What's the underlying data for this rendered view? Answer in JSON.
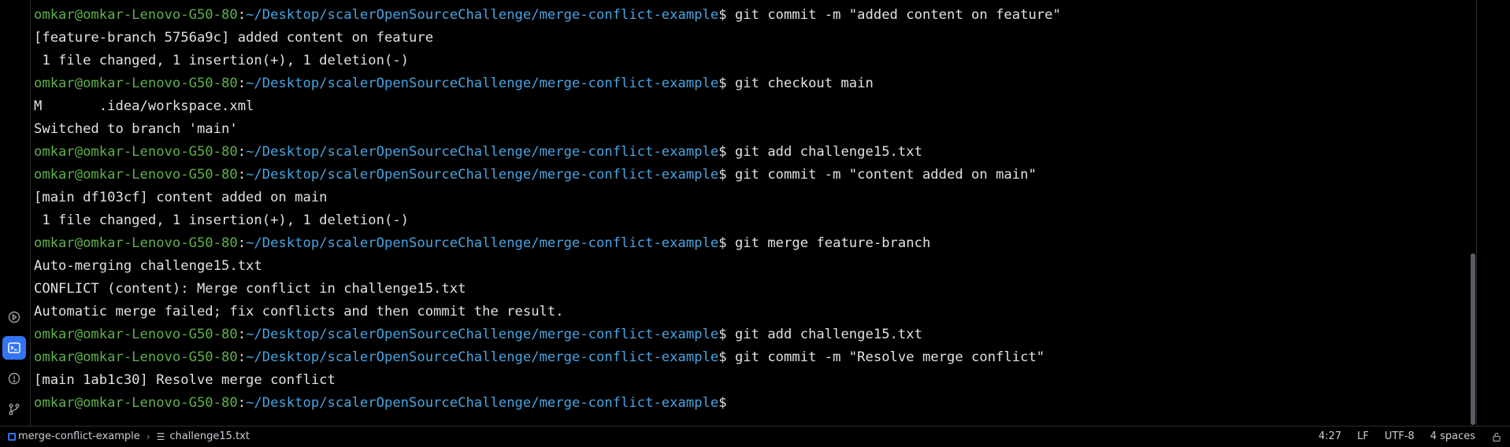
{
  "terminal": {
    "lines": [
      {
        "user": "omkar@omkar-Lenovo-G50-80",
        "path": "~/Desktop/scalerOpenSourceChallenge/merge-conflict-example",
        "cmd": " git commit -m \"added content on feature\""
      },
      {
        "text": "[feature-branch 5756a9c] added content on feature"
      },
      {
        "text": " 1 file changed, 1 insertion(+), 1 deletion(-)"
      },
      {
        "user": "omkar@omkar-Lenovo-G50-80",
        "path": "~/Desktop/scalerOpenSourceChallenge/merge-conflict-example",
        "cmd": " git checkout main"
      },
      {
        "text": "M       .idea/workspace.xml"
      },
      {
        "text": "Switched to branch 'main'"
      },
      {
        "user": "omkar@omkar-Lenovo-G50-80",
        "path": "~/Desktop/scalerOpenSourceChallenge/merge-conflict-example",
        "cmd": " git add challenge15.txt"
      },
      {
        "user": "omkar@omkar-Lenovo-G50-80",
        "path": "~/Desktop/scalerOpenSourceChallenge/merge-conflict-example",
        "cmd": " git commit -m \"content added on main\""
      },
      {
        "text": "[main df103cf] content added on main"
      },
      {
        "text": " 1 file changed, 1 insertion(+), 1 deletion(-)"
      },
      {
        "user": "omkar@omkar-Lenovo-G50-80",
        "path": "~/Desktop/scalerOpenSourceChallenge/merge-conflict-example",
        "cmd": " git merge feature-branch"
      },
      {
        "text": "Auto-merging challenge15.txt"
      },
      {
        "text": "CONFLICT (content): Merge conflict in challenge15.txt"
      },
      {
        "text": "Automatic merge failed; fix conflicts and then commit the result."
      },
      {
        "user": "omkar@omkar-Lenovo-G50-80",
        "path": "~/Desktop/scalerOpenSourceChallenge/merge-conflict-example",
        "cmd": " git add challenge15.txt"
      },
      {
        "user": "omkar@omkar-Lenovo-G50-80",
        "path": "~/Desktop/scalerOpenSourceChallenge/merge-conflict-example",
        "cmd": " git commit -m \"Resolve merge conflict\""
      },
      {
        "text": "[main 1ab1c30] Resolve merge conflict"
      },
      {
        "user": "omkar@omkar-Lenovo-G50-80",
        "path": "~/Desktop/scalerOpenSourceChallenge/merge-conflict-example",
        "cmd": ""
      }
    ],
    "prompt_colon": ":",
    "prompt_dollar": "$"
  },
  "sidebar": {
    "icons": [
      "run-icon",
      "terminal-icon",
      "problems-icon",
      "git-icon"
    ],
    "active": "terminal-icon"
  },
  "status_bar": {
    "project": "merge-conflict-example",
    "file": "challenge15.txt",
    "position": "4:27",
    "line_separator": "LF",
    "encoding": "UTF-8",
    "indent": "4 spaces"
  },
  "colors": {
    "background": "#000000",
    "user": "#5fb04a",
    "path": "#4aa3e0",
    "text": "#dfe1e5",
    "accent": "#3574f0"
  }
}
